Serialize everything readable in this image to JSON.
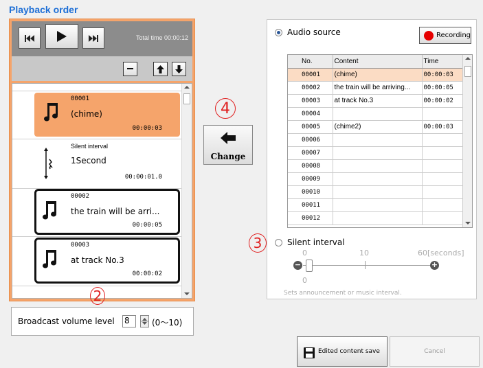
{
  "title": "Playback order",
  "player": {
    "total_time": "Total time  00:00:12"
  },
  "list": {
    "items": [
      {
        "id": "00001",
        "name": "(chime)",
        "time": "00:00:03"
      },
      {
        "id": "Silent interval",
        "name": "1Second",
        "time": "00:00:01.0"
      },
      {
        "id": "00002",
        "name": "the train will be arri...",
        "time": "00:00:05"
      },
      {
        "id": "00003",
        "name": "at track No.3",
        "time": "00:00:02"
      }
    ]
  },
  "volume": {
    "label": "Broadcast volume level",
    "value": "8",
    "range": "(0〜10)"
  },
  "change": {
    "label": "Change"
  },
  "callouts": {
    "c2": "2",
    "c3": "3",
    "c4": "4"
  },
  "audio_source": {
    "label": "Audio source",
    "recording_label": "Recording",
    "columns": [
      "No.",
      "Content",
      "Time"
    ],
    "rows": [
      {
        "no": "00001",
        "content": "(chime)",
        "time": "00:00:03"
      },
      {
        "no": "00002",
        "content": "the train will be arriving...",
        "time": "00:00:05"
      },
      {
        "no": "00003",
        "content": "at track No.3",
        "time": "00:00:02"
      },
      {
        "no": "00004",
        "content": "",
        "time": ""
      },
      {
        "no": "00005",
        "content": "(chime2)",
        "time": "00:00:03"
      },
      {
        "no": "00006",
        "content": "",
        "time": ""
      },
      {
        "no": "00007",
        "content": "",
        "time": ""
      },
      {
        "no": "00008",
        "content": "",
        "time": ""
      },
      {
        "no": "00009",
        "content": "",
        "time": ""
      },
      {
        "no": "00010",
        "content": "",
        "time": ""
      },
      {
        "no": "00011",
        "content": "",
        "time": ""
      },
      {
        "no": "00012",
        "content": "",
        "time": ""
      }
    ]
  },
  "silent_interval": {
    "label": "Silent interval",
    "scale_0": "0",
    "scale_10": "10",
    "scale_60": "60[seconds]",
    "value": "0",
    "hint": "Sets announcement or music interval."
  },
  "buttons": {
    "save": "Edited content save",
    "cancel": "Cancel"
  }
}
